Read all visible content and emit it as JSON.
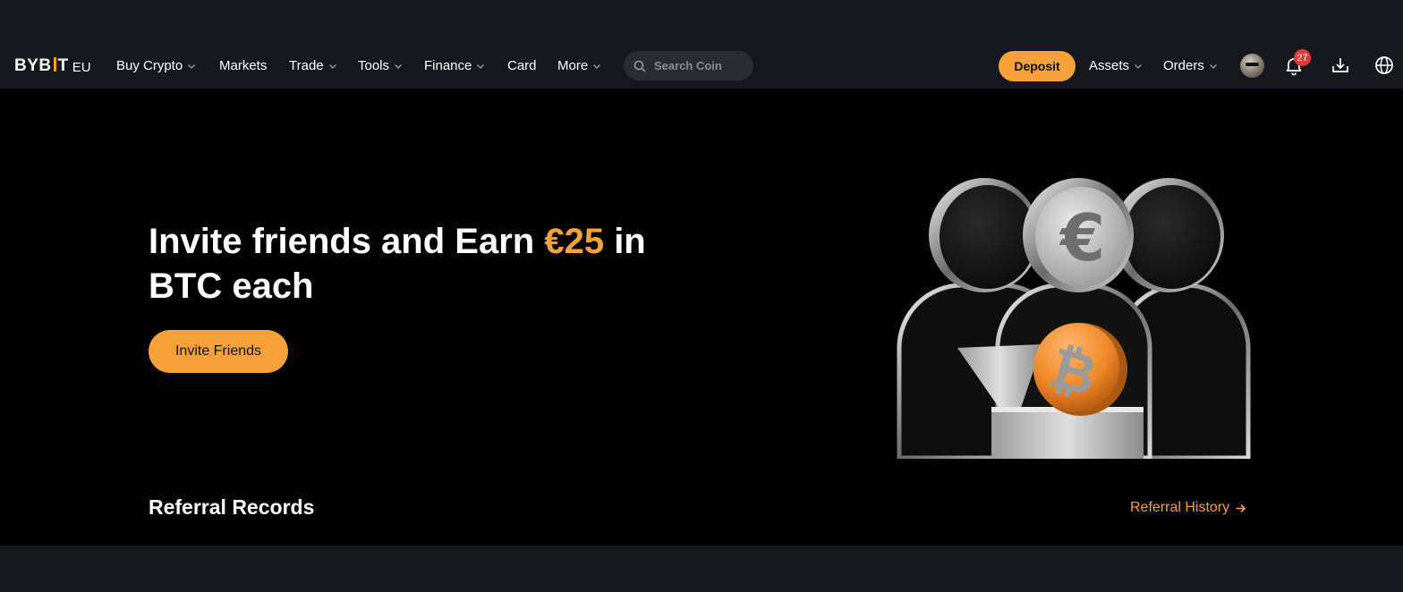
{
  "header": {
    "logo": {
      "text": "BYB",
      "text_end": "T",
      "suffix": "EU"
    },
    "nav_items": [
      {
        "label": "Buy Crypto",
        "has_dropdown": true
      },
      {
        "label": "Markets",
        "has_dropdown": false
      },
      {
        "label": "Trade",
        "has_dropdown": true
      },
      {
        "label": "Tools",
        "has_dropdown": true
      },
      {
        "label": "Finance",
        "has_dropdown": true
      },
      {
        "label": "Card",
        "has_dropdown": false
      },
      {
        "label": "More",
        "has_dropdown": true
      }
    ],
    "search": {
      "placeholder": "Search Coin",
      "icon": "search-icon"
    },
    "deposit_label": "Deposit",
    "assets_label": "Assets",
    "orders_label": "Orders",
    "notifications_count": "27",
    "icons": [
      "chevron-down-icon",
      "bell-icon",
      "download-icon",
      "globe-icon"
    ]
  },
  "hero": {
    "headline_part1": "Invite friends and Earn ",
    "headline_amount": "€25",
    "headline_part2": " in BTC each",
    "cta_label": "Invite Friends",
    "illustration": "referral-coins-illustration"
  },
  "records": {
    "title": "Referral Records",
    "history_link": "Referral History"
  },
  "colors": {
    "accent": "#f7a13a",
    "background": "#000000",
    "nav_background": "#17181e",
    "badge": "#e23a3a"
  }
}
